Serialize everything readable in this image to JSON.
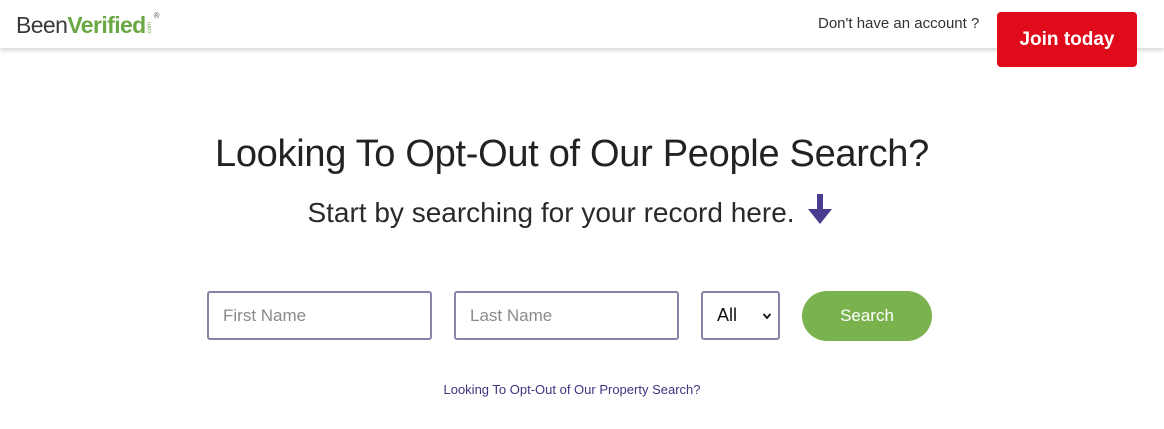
{
  "header": {
    "logo": {
      "part1": "Been",
      "part2": "Verified",
      "suffix": ".com",
      "reg_mark": "®"
    },
    "account_prompt": "Don't have an account ?",
    "join_label": "Join today"
  },
  "main": {
    "headline": "Looking To Opt-Out of Our People Search?",
    "subheadline": "Start by searching for your record here.",
    "arrow_icon": "arrow-down-icon",
    "form": {
      "first_name_placeholder": "First Name",
      "first_name_value": "",
      "last_name_placeholder": "Last Name",
      "last_name_value": "",
      "state_selected": "All",
      "search_label": "Search"
    },
    "property_link": "Looking To Opt-Out of Our Property Search?"
  },
  "colors": {
    "brand_green": "#6aa843",
    "join_red": "#df0a1a",
    "search_green": "#7ab24e",
    "arrow_purple": "#4a3d8f",
    "link_purple": "#3f3580",
    "input_border": "#8a80a8"
  }
}
